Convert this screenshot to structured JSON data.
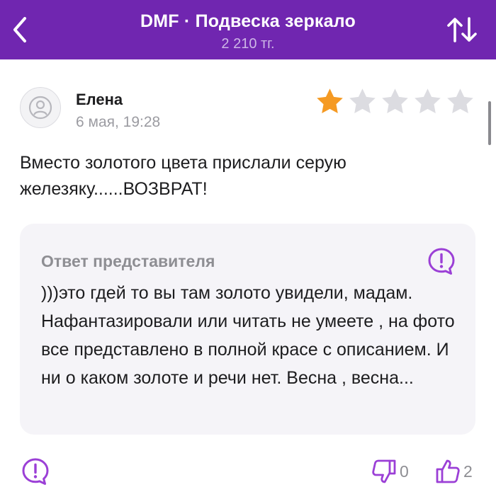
{
  "header": {
    "title": "DMF · Подвеска зеркало",
    "price": "2 210 тг.",
    "icons": {
      "back": "chevron-left-icon",
      "sort": "sort-arrows-icon"
    },
    "colors": {
      "background": "#7026b0",
      "text": "#ffffff",
      "subtext": "#cdb6e6"
    }
  },
  "review": {
    "author": "Елена",
    "date": "6 мая, 19:28",
    "rating": 1,
    "max_rating": 5,
    "text": "Вместо золотого цвета прислали серую железяку......ВОЗВРАТ!",
    "icons": {
      "avatar": "user-icon",
      "star": "star-icon"
    },
    "colors": {
      "star_active": "#f59a23",
      "star_inactive": "#dcdce1"
    }
  },
  "reply": {
    "title": "Ответ представителя",
    "text": ")))это гдей то вы там золото увидели, мадам. Нафантазировали или читать не умеете , на фото все представлено в полной красе с описанием. И ни о каком золоте и речи нет. Весна , весна...",
    "icon": "report-icon"
  },
  "actions": {
    "report_icon": "report-icon",
    "dislike_icon": "thumbs-down-icon",
    "dislike_count": "0",
    "like_icon": "thumbs-up-icon",
    "like_count": "2",
    "accent": "#9b3fd6"
  }
}
